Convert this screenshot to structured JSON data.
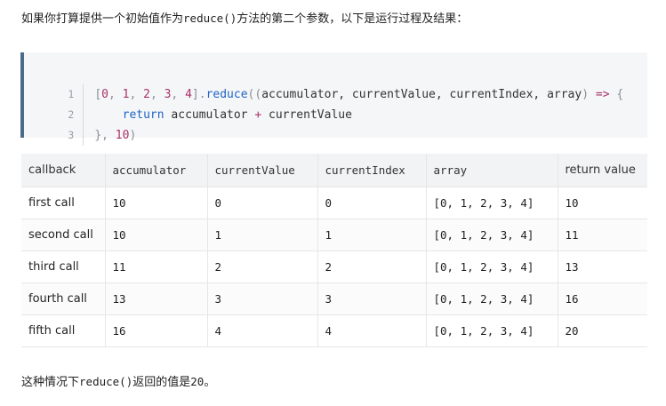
{
  "intro": {
    "text_before": "如果你打算提供一个初始值作为",
    "code": "reduce()",
    "text_after": "方法的第二个参数，以下是运行过程及结果："
  },
  "code_block": {
    "line_numbers": [
      "1",
      "2",
      "3"
    ],
    "line1": {
      "open_bracket": "[",
      "n0": "0",
      "sep1": ", ",
      "n1": "1",
      "sep2": ", ",
      "n2": "2",
      "sep3": ", ",
      "n3": "3",
      "sep4": ", ",
      "n4": "4",
      "close_bracket": "]",
      "dot": ".",
      "method": "reduce",
      "params_open": "((",
      "params": "accumulator, currentValue, currentIndex, array",
      "params_close": ") ",
      "arrow": "=>",
      "brace_open": " {"
    },
    "line2": {
      "indent": "    ",
      "keyword": "return",
      "expr_left": " accumulator ",
      "op": "+",
      "expr_right": " currentValue"
    },
    "line3": {
      "close": "}, ",
      "initial": "10",
      "paren": ")"
    }
  },
  "table": {
    "headers": [
      "callback",
      "accumulator",
      "currentValue",
      "currentIndex",
      "array",
      "return value"
    ],
    "rows": [
      [
        "first call",
        "10",
        "0",
        "0",
        "[0, 1, 2, 3, 4]",
        "10"
      ],
      [
        "second call",
        "10",
        "1",
        "1",
        "[0, 1, 2, 3, 4]",
        "11"
      ],
      [
        "third call",
        "11",
        "2",
        "2",
        "[0, 1, 2, 3, 4]",
        "13"
      ],
      [
        "fourth call",
        "13",
        "3",
        "3",
        "[0, 1, 2, 3, 4]",
        "16"
      ],
      [
        "fifth call",
        "16",
        "4",
        "4",
        "[0, 1, 2, 3, 4]",
        "20"
      ]
    ]
  },
  "conclusion": {
    "text_before": "这种情况下",
    "code": "reduce()",
    "text_middle": "返回的值是",
    "value": "20",
    "text_after": "。"
  }
}
